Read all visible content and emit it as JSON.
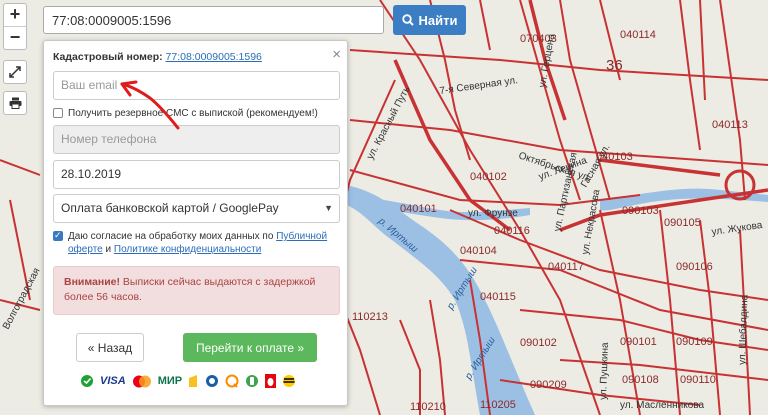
{
  "colors": {
    "road": "#c83232",
    "water": "#9cc0e4",
    "accent": "#3c7ec4",
    "pay": "#5cb85c",
    "alert_bg": "#f2dede"
  },
  "map": {
    "parcels": [
      "040114",
      "070403",
      "040113",
      "040103",
      "040102",
      "040101",
      "040104",
      "040116",
      "040115",
      "040117",
      "110213",
      "090103",
      "090105",
      "090106",
      "090102",
      "090101",
      "090108",
      "090109",
      "090110",
      "090209",
      "110210",
      "110205"
    ],
    "big_number": "36",
    "streets": {
      "krasny_put": "ул. Красный Путь",
      "gertsena": "ул. Герцена",
      "frunze": "ул. Фрунзе",
      "oktyabrskaya": "Октябрьская ул.",
      "severnaya": "7-я Северная ул.",
      "shebaldina": "ул. Шебалдина",
      "maslennikova": "ул. Масленникова",
      "volgogradskaya": "Волгоградская",
      "pushkina": "ул. Пушкина",
      "nekrasova": "ул. Некрасова",
      "gasnaya": "Гасная ул.",
      "partizanskaya": "ул. Партизанская",
      "zhukova": "ул. Жукова",
      "lenina": "ул. Ленина"
    },
    "rivers": {
      "irtysh": "р. Иртыш"
    }
  },
  "controls": {
    "zoom_in": "+",
    "zoom_out": "−"
  },
  "search": {
    "value": "77:08:0009005:1596",
    "button": "Найти"
  },
  "panel": {
    "cadastral_label": "Кадастровый номер:",
    "cadastral_value": "77:08:0009005:1596",
    "email_placeholder": "Ваш email",
    "sms_label": "Получить резервное СМС с выпиской (рекомендуем!)",
    "phone_placeholder": "Номер телефона",
    "date_value": "28.10.2019",
    "payment_method": "Оплата банковской картой / GooglePay",
    "consent_text": "Даю согласие на обработку моих данных по",
    "consent_offer": "Публичной оферте",
    "consent_and": "и",
    "consent_policy": "Политике конфиденциальности",
    "alert_strong": "Внимание!",
    "alert_text": "Выписки сейчас выдаются с задержкой более 56 часов.",
    "back_button": "« Назад",
    "pay_button": "Перейти к оплате »",
    "payment_icons": [
      "sber-icon",
      "visa-icon",
      "mastercard-icon",
      "mir-icon",
      "yandex-money-icon",
      "webmoney-icon",
      "qiwi-icon",
      "mobile-pay-icon",
      "mts-icon",
      "beeline-icon"
    ],
    "payment_visa": "VISA",
    "payment_mir": "МИР"
  }
}
